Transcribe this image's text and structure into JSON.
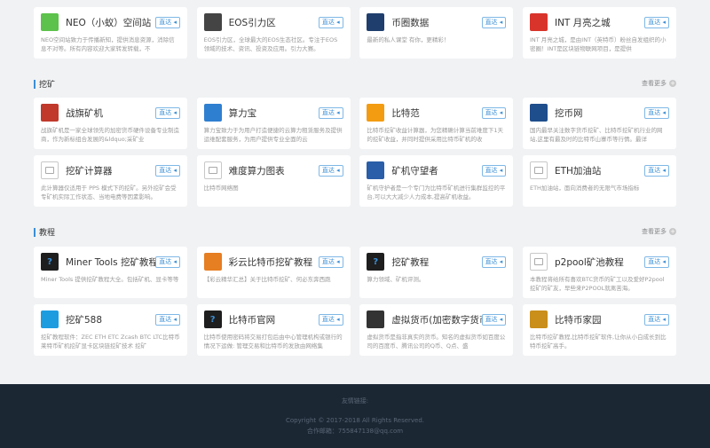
{
  "go_label": "直达 ◂",
  "sections": {
    "mining": {
      "name": "挖矿",
      "more": "查看更多"
    },
    "tutorial": {
      "name": "教程",
      "more": "查看更多"
    }
  },
  "top_row": [
    {
      "title": "NEO（小蚁）空间站",
      "desc": "NEO空间站致力于传播新知，提供消息资源，消除信息不对等。所有内容欢迎大家转发转载，不",
      "logo": "neo-logo",
      "color": "#5cc24b"
    },
    {
      "title": "EOS引力区",
      "desc": "EOS引力区，全球最大的EOS生态社区。专注于EOS领域的技术、资讯、投资及应用。引力大赛。",
      "logo": "eos-logo",
      "color": "#444444"
    },
    {
      "title": "币圈数据",
      "desc": "最新的私人课堂 有你，更精彩！",
      "logo": "coin-data-logo",
      "color": "#1f3e6e"
    },
    {
      "title": "INT 月亮之城",
      "desc": "INT 月亮之城，是由INT（英特币）粉丝自发组织的小密圈！INT是区块链物联网项目，是提供",
      "logo": "int-logo",
      "color": "#d9342b"
    }
  ],
  "mining_row1": [
    {
      "title": "战旗矿机",
      "desc": "战旗矿机是一家全球领先的加密货币硬件设备专业制造商，作为新标组合发展的&ldquo;采矿业",
      "logo": "zhanqi-logo",
      "color": "#c0392b"
    },
    {
      "title": "算力宝",
      "desc": "算力宝致力于为用户打造便捷的云算力租赁服务及提供运维配套服务，为用户提供专业全面的云",
      "logo": "suanlibao-logo",
      "color": "#2f7fd1"
    },
    {
      "title": "比特范",
      "desc": "比特币挖矿收益计算器，为您精确计算当前难度下1天的挖矿收益，并同时提供采用比特币矿机的收",
      "logo": "bitfan-logo",
      "color": "#f39c12"
    },
    {
      "title": "挖币网",
      "desc": "国内最早关注数字货币挖矿、比特币挖矿机行业的网站,这里有最及时的比特币山寨币等行情。最详",
      "logo": "wabi-logo",
      "color": "#1f4e8c"
    }
  ],
  "mining_row2": [
    {
      "title": "挖矿计算器",
      "desc": "此计算器仅适用于 PPS 模式下的挖矿。另外挖矿会受专矿机实际工作状态、当地电费等因素影响。",
      "logo": "calc-image-icon",
      "color": ""
    },
    {
      "title": "难度算力图表",
      "desc": "比特币网络图",
      "logo": "chart-image-icon",
      "color": ""
    },
    {
      "title": "矿机守望者",
      "desc": "矿机守护者是一个专门为比特币矿机进行集群监控的平台,可以大大减少人力成本,提高矿机收益。",
      "logo": "watcher-logo",
      "color": "#2a5ea8"
    },
    {
      "title": "ETH加油站",
      "desc": "ETH加油站，面向消费者的无限气市场指标",
      "logo": "eth-image-icon",
      "color": ""
    }
  ],
  "tutorial_row1": [
    {
      "title": "Miner Tools 挖矿教程",
      "desc": "Miner Tools 提供挖矿教程大全。包括矿机、显卡等等",
      "logo": "question-logo",
      "color": "#1e1e1e"
    },
    {
      "title": "彩云比特币挖矿教程",
      "desc": "【彩云精华汇总】关于比特币挖矿、何必东奔西跑",
      "logo": "caiyun-logo",
      "color": "#e67e22"
    },
    {
      "title": "挖矿教程",
      "desc": "算力领域、矿机评测。",
      "logo": "question-logo",
      "color": "#1e1e1e"
    },
    {
      "title": "p2pool矿池教程",
      "desc": "本教程将给所有喜欢BTC货币的矿工以及爱好P2pool挖矿的矿友，早些来P2POOL就离苦海。",
      "logo": "p2pool-image-icon",
      "color": ""
    }
  ],
  "tutorial_row2": [
    {
      "title": "挖矿588",
      "desc": "挖矿教程软件：ZEC ETH ETC Zcash BTC LTC比特币莱特币矿机挖矿显卡区块链挖矿技术 挖矿",
      "logo": "wakuang588-logo",
      "color": "#1d9ce0"
    },
    {
      "title": "比特币官网",
      "desc": "比特币使用密码将交易打包后由中心管理机构或银行的情况下运做: 管理交易和比特币的发放由网络集",
      "logo": "question-logo",
      "color": "#1e1e1e"
    },
    {
      "title": "虚拟货币(加密数字货币)",
      "desc": "虚拟货币是指非真实的货币。知名的虚拟货币如百度公司的百度币、腾讯公司的Q币、Q点、盛",
      "logo": "virtual-coin-logo",
      "color": "#333333"
    },
    {
      "title": "比特币家园",
      "desc": "比特币挖矿教程,比特币挖矿软件,让你从小白成长到比特币挖矿高手。",
      "logo": "bitjia-logo",
      "color": "#c98f1a"
    }
  ],
  "footer": {
    "links_label": "友情链接:",
    "copyright": "Copyright © 2017-2018 All Rights Reserved.",
    "contact": "合作邮箱：755847138@qq.com"
  }
}
